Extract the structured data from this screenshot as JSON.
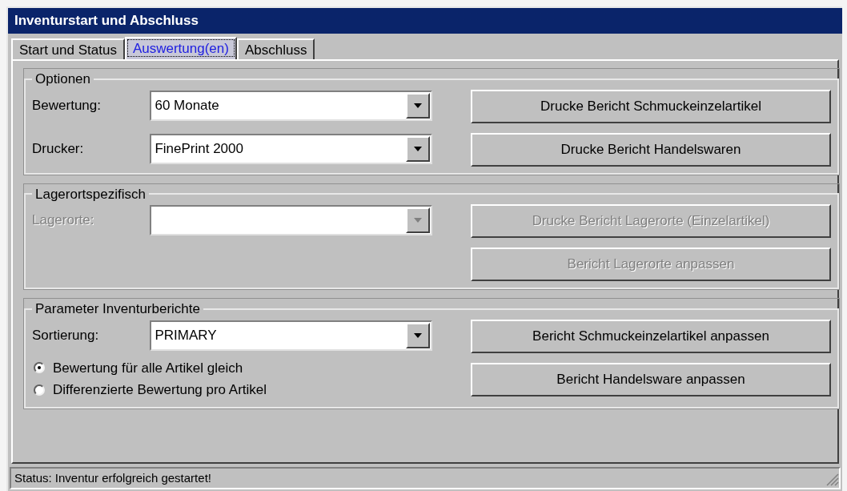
{
  "window": {
    "title": "Inventurstart und Abschluss"
  },
  "tabs": [
    {
      "label": "Start und Status",
      "selected": false
    },
    {
      "label": "Auswertung(en)",
      "selected": true
    },
    {
      "label": "Abschluss",
      "selected": false
    }
  ],
  "groups": [
    {
      "title": "Optionen",
      "fields": [
        {
          "label": "Bewertung:",
          "value": "60 Monate",
          "disabled": false
        },
        {
          "label": "Drucker:",
          "value": "FinePrint 2000",
          "disabled": false
        }
      ],
      "buttons": [
        {
          "label": "Drucke Bericht Schmuckeinzelartikel",
          "disabled": false
        },
        {
          "label": "Drucke Bericht Handelswaren",
          "disabled": false
        }
      ]
    },
    {
      "title": "Lagerortspezifisch",
      "fields": [
        {
          "label": "Lagerorte:",
          "disabled": true
        }
      ],
      "buttons": [
        {
          "label": "Drucke Bericht Lagerorte (Einzelartikel)",
          "disabled": true
        },
        {
          "label": "Bericht Lagerorte anpassen",
          "disabled": true
        }
      ]
    },
    {
      "title": "Parameter Inventurberichte",
      "fields": [
        {
          "label": "Sortierung:",
          "value": "PRIMARY",
          "disabled": false
        }
      ],
      "radios": [
        {
          "label": "Bewertung für alle Artikel gleich",
          "selected": true
        },
        {
          "label": "Differenzierte Bewertung pro Artikel",
          "selected": false
        }
      ],
      "buttons": [
        {
          "label": "Bericht Schmuckeinzelartikel anpassen",
          "disabled": false
        },
        {
          "label": "Bericht Handelsware anpassen",
          "disabled": false
        }
      ]
    }
  ],
  "status_bar": "Status: Inventur erfolgreich gestartet!"
}
